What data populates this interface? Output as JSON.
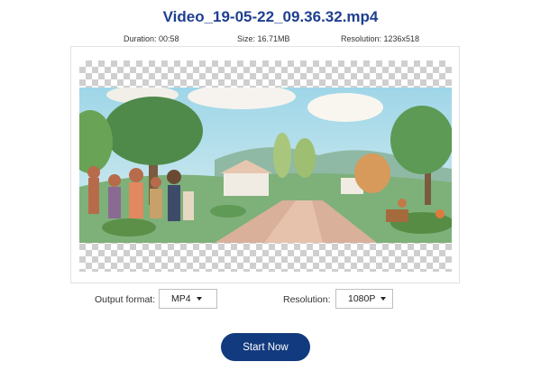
{
  "file": {
    "title": "Video_19-05-22_09.36.32.mp4",
    "duration": "Duration: 00:58",
    "size": "Size: 16.71MB",
    "resolution": "Resolution: 1236x518"
  },
  "settings": {
    "output_format_label": "Output format:",
    "output_format_value": "MP4",
    "resolution_label": "Resolution:",
    "resolution_value": "1080P"
  },
  "actions": {
    "start_label": "Start Now"
  },
  "colors": {
    "title": "#1f3f8f",
    "button": "#123a7e"
  },
  "icons": {
    "dropdown": "chevron-down-icon"
  }
}
